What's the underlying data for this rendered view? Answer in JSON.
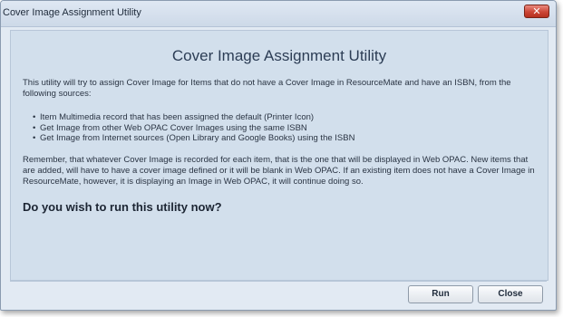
{
  "window": {
    "title": "Cover Image Assignment Utility",
    "close_glyph": "✕",
    "close_button_color": "#cc4636"
  },
  "content": {
    "heading": "Cover Image Assignment Utility",
    "intro": "This utility will try to assign Cover Image for Items that do not have a Cover Image in ResourceMate and have an ISBN, from the following sources:",
    "sources": [
      "Item Multimedia record that has been assigned the default (Printer Icon)",
      "Get Image from other Web OPAC Cover Images using the same ISBN",
      "Get Image from Internet sources (Open Library and Google Books) using the ISBN"
    ],
    "note": "Remember, that whatever Cover Image is recorded for each item, that is the one that will be displayed in Web OPAC.   New items that are added, will have to have a cover image defined or it will be blank in Web OPAC.   If an existing item does not have a Cover Image in ResourceMate, however, it is displaying an Image in Web OPAC, it will continue doing so.",
    "question": "Do you wish to run this utility now?"
  },
  "buttons": {
    "run_label": "Run",
    "close_label": "Close"
  }
}
